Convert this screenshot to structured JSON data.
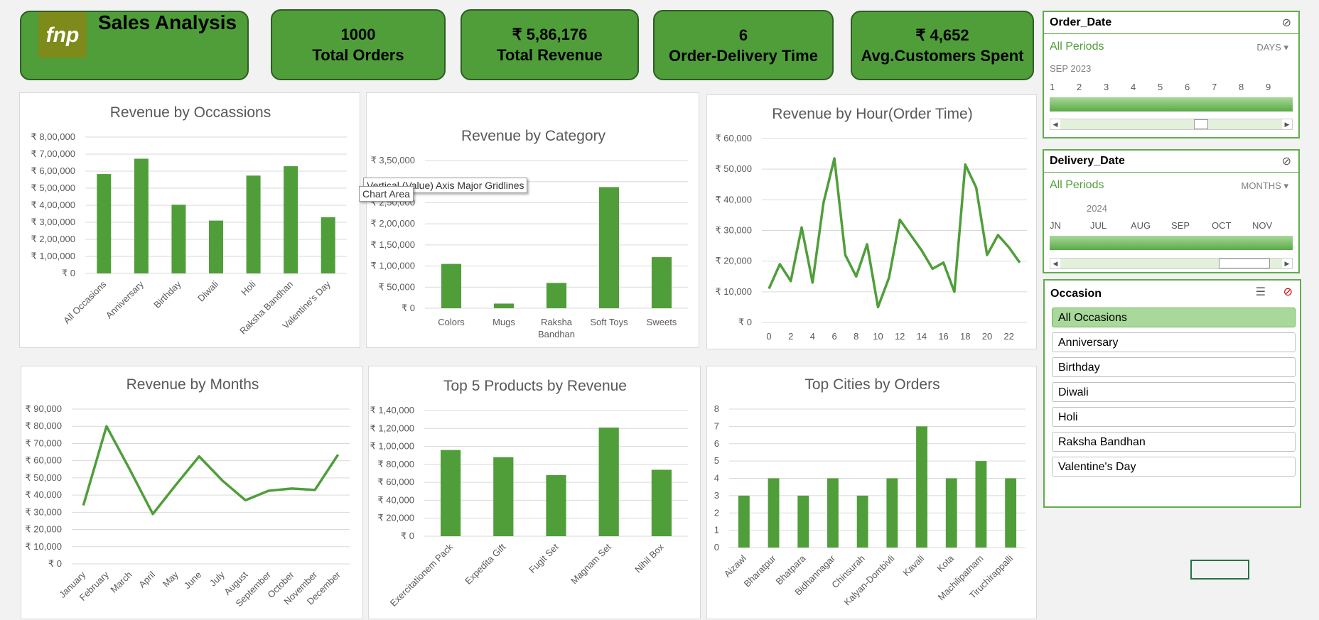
{
  "header": {
    "brand": {
      "logo_text": "fnp",
      "title": "Sales Analysis"
    },
    "kpis": [
      {
        "value": "1000",
        "label": "Total Orders"
      },
      {
        "value": "₹ 5,86,176",
        "label": "Total Revenue"
      },
      {
        "value": "6",
        "label": "Order-Delivery Time"
      },
      {
        "value": "₹ 4,652",
        "label": "Avg.Customers Spent"
      }
    ]
  },
  "tooltip": {
    "gridlines": "Vertical (Value) Axis Major Gridlines",
    "chart_area": "Chart Area"
  },
  "slicers": {
    "order_date": {
      "title": "Order_Date",
      "period": "All Periods",
      "unit": "DAYS",
      "year": "SEP 2023",
      "ticks": [
        "1",
        "2",
        "3",
        "4",
        "5",
        "6",
        "7",
        "8",
        "9"
      ],
      "position": 0.64
    },
    "delivery_date": {
      "title": "Delivery_Date",
      "period": "All Periods",
      "unit": "MONTHS",
      "year": "2024",
      "ticks": [
        "JN",
        "JUL",
        "AUG",
        "SEP",
        "OCT",
        "NOV"
      ],
      "position": 0.92
    },
    "occasion": {
      "title": "Occasion",
      "items": [
        "All Occasions",
        "Anniversary",
        "Birthday",
        "Diwali",
        "Holi",
        "Raksha Bandhan",
        "Valentine's Day"
      ],
      "selected": "All Occasions"
    }
  },
  "colors": {
    "accent": "#4f9e3a",
    "kpi_border": "#2d5e22",
    "slicer_border": "#5fae4a"
  },
  "chart_data": [
    {
      "id": "occasions",
      "type": "bar",
      "title": "Revenue by Occassions",
      "categories": [
        "All Occasions",
        "Anniversary",
        "Birthday",
        "Diwali",
        "Holi",
        "Raksha Bandhan",
        "Valentine's Day"
      ],
      "values": [
        583000,
        673000,
        403000,
        310000,
        574000,
        629000,
        330000
      ],
      "ylim": [
        0,
        800000
      ],
      "yticks": [
        "₹ 0",
        "₹ 1,00,000",
        "₹ 2,00,000",
        "₹ 3,00,000",
        "₹ 4,00,000",
        "₹ 5,00,000",
        "₹ 6,00,000",
        "₹ 7,00,000",
        "₹ 8,00,000"
      ],
      "rotate": true
    },
    {
      "id": "category",
      "type": "bar",
      "title": "Revenue by Category",
      "categories": [
        "Colors",
        "Mugs",
        "Raksha Bandhan",
        "Soft Toys",
        "Sweets"
      ],
      "values": [
        105000,
        11000,
        60000,
        287000,
        121000
      ],
      "ylim": [
        0,
        350000
      ],
      "yticks": [
        "₹ 0",
        "₹ 50,000",
        "₹ 1,00,000",
        "₹ 1,50,000",
        "₹ 2,00,000",
        "₹ 2,50,000",
        "₹ 3,00,000",
        "₹ 3,50,000"
      ],
      "rotate": false
    },
    {
      "id": "hour",
      "type": "line",
      "title": "Revenue by Hour(Order Time)",
      "x": [
        0,
        1,
        2,
        3,
        4,
        5,
        6,
        7,
        8,
        9,
        10,
        11,
        12,
        13,
        14,
        15,
        16,
        17,
        18,
        19,
        20,
        21,
        22,
        23
      ],
      "values": [
        11000,
        19000,
        13500,
        31000,
        13000,
        39000,
        53500,
        22000,
        15000,
        25500,
        5000,
        14500,
        33500,
        28500,
        23500,
        17500,
        19500,
        10000,
        51500,
        44000,
        22000,
        28500,
        24500,
        19500
      ],
      "ylim": [
        0,
        60000
      ],
      "yticks": [
        "₹ 0",
        "₹ 10,000",
        "₹ 20,000",
        "₹ 30,000",
        "₹ 40,000",
        "₹ 50,000",
        "₹ 60,000"
      ],
      "xticks": [
        "0",
        "2",
        "4",
        "6",
        "8",
        "10",
        "12",
        "14",
        "16",
        "18",
        "20",
        "22"
      ]
    },
    {
      "id": "months",
      "type": "line",
      "title": "Revenue by Months",
      "categories": [
        "January",
        "February",
        "March",
        "April",
        "May",
        "June",
        "July",
        "August",
        "September",
        "October",
        "November",
        "December"
      ],
      "values": [
        34000,
        80000,
        55000,
        29000,
        46000,
        62500,
        48500,
        37000,
        42500,
        43800,
        43000,
        63500
      ],
      "ylim": [
        0,
        90000
      ],
      "yticks": [
        "₹ 0",
        "₹ 10,000",
        "₹ 20,000",
        "₹ 30,000",
        "₹ 40,000",
        "₹ 50,000",
        "₹ 60,000",
        "₹ 70,000",
        "₹ 80,000",
        "₹ 90,000"
      ],
      "rotate": true
    },
    {
      "id": "products",
      "type": "bar",
      "title": "Top 5 Products by Revenue",
      "categories": [
        "Exercitationem Pack",
        "Expedita Gift",
        "Fugit Set",
        "Magnam Set",
        "Nihil Box"
      ],
      "values": [
        96000,
        88000,
        68000,
        121000,
        74000
      ],
      "ylim": [
        0,
        140000
      ],
      "yticks": [
        "₹ 0",
        "₹ 20,000",
        "₹ 40,000",
        "₹ 60,000",
        "₹ 80,000",
        "₹ 1,00,000",
        "₹ 1,20,000",
        "₹ 1,40,000"
      ],
      "rotate": true
    },
    {
      "id": "cities",
      "type": "bar",
      "title": "Top Cities by Orders",
      "categories": [
        "Aizawl",
        "Bharatpur",
        "Bhatpara",
        "Bidhannagar",
        "Chinsurah",
        "Kalyan-Dombivli",
        "Kavali",
        "Kota",
        "Machilipatnam",
        "Tiruchirappalli"
      ],
      "values": [
        3,
        4,
        3,
        4,
        3,
        4,
        7,
        4,
        5,
        4
      ],
      "ylim": [
        0,
        8
      ],
      "yticks": [
        "0",
        "1",
        "2",
        "3",
        "4",
        "5",
        "6",
        "7",
        "8"
      ],
      "rotate": true
    }
  ]
}
